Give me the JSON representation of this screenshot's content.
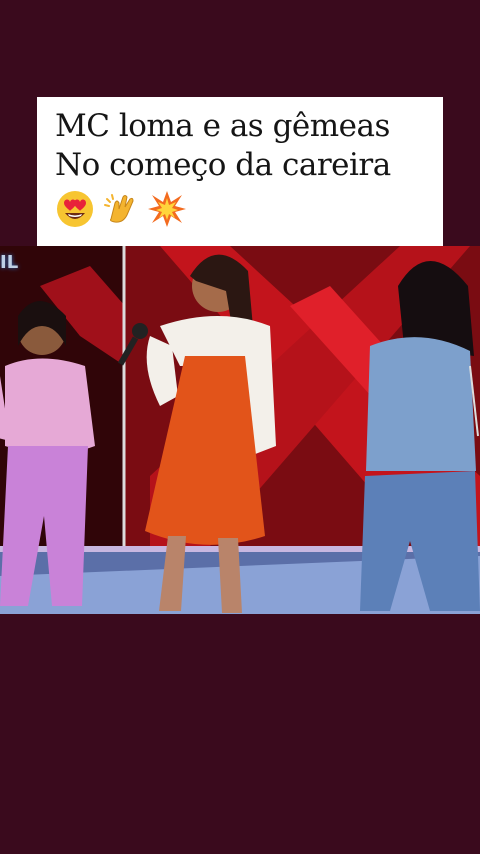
{
  "caption": {
    "line1": "MC loma e as gêmeas",
    "line2": "No começo da careira",
    "emojis": [
      "heart-eyes-face",
      "clapping-hands",
      "collision"
    ]
  },
  "video": {
    "watermark": "IL"
  },
  "colors": {
    "background": "#3a0a1d",
    "caption_bg": "#ffffff",
    "stage_red": "#c3141c",
    "dress_orange": "#e2541a"
  }
}
